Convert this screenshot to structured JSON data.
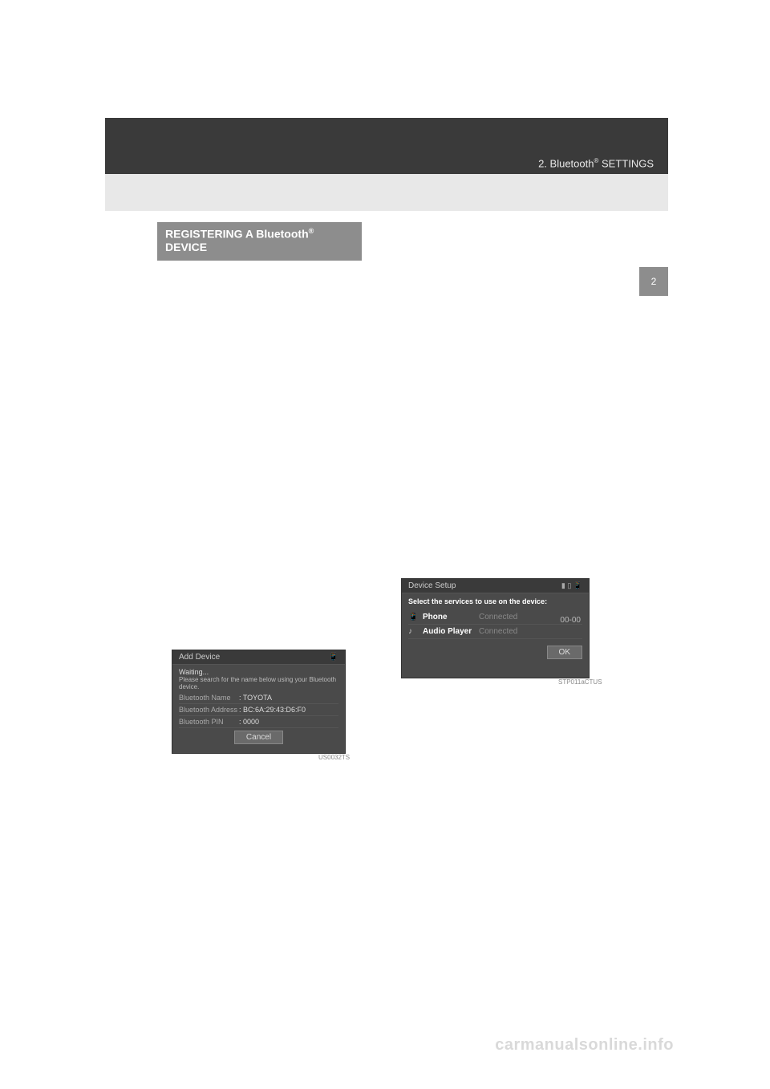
{
  "header": {
    "breadcrumb_prefix": "2. Bluetooth",
    "breadcrumb_suffix": " SETTINGS"
  },
  "sideTab": {
    "number": "2"
  },
  "sectionHeading": {
    "line1_prefix": "REGISTERING A Bluetooth",
    "line2": "DEVICE"
  },
  "screenshotLeft": {
    "title": "Add Device",
    "waiting": "Waiting...",
    "instruction": "Please search for the name below using your Bluetooth device.",
    "rows": [
      {
        "label": "Bluetooth Name",
        "value": ": TOYOTA"
      },
      {
        "label": "Bluetooth Address",
        "value": ": BC:6A:29:43:D6:F0"
      },
      {
        "label": "Bluetooth PIN",
        "value": ": 0000"
      }
    ],
    "cancelButton": "Cancel",
    "imageId": "US0032TS"
  },
  "screenshotRight": {
    "title": "Device Setup",
    "instruction": "Select the services to use on the device:",
    "clock": "00-00",
    "services": [
      {
        "icon": "phone",
        "label": "Phone",
        "status": "Connected"
      },
      {
        "icon": "music",
        "label": "Audio Player",
        "status": "Connected"
      }
    ],
    "okButton": "OK",
    "imageId": "STP011aCTUS"
  },
  "watermark": "carmanualsonline.info"
}
